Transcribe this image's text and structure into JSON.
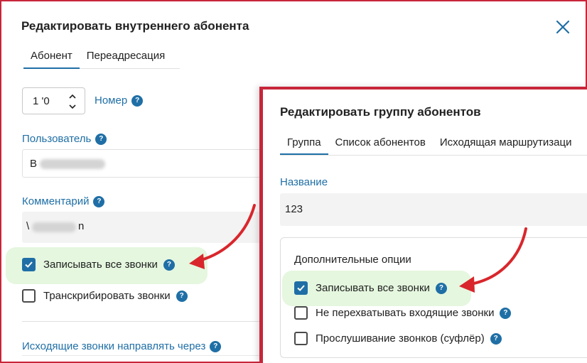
{
  "dialog_user": {
    "title": "Редактировать внутреннего абонента",
    "tabs": [
      {
        "label": "Абонент",
        "active": true
      },
      {
        "label": "Переадресация",
        "active": false
      }
    ],
    "number_value": "1 '0",
    "number_label": "Номер",
    "user_label": "Пользователь",
    "user_value": "В",
    "comment_label": "Комментарий",
    "comment_value_start": "\\",
    "comment_value_end": "n",
    "checkboxes": [
      {
        "label": "Записывать все звонки",
        "checked": true
      },
      {
        "label": "Транскрибировать звонки",
        "checked": false
      }
    ],
    "outgoing_label": "Исходящие звонки направлять через"
  },
  "dialog_group": {
    "title": "Редактировать группу абонентов",
    "tabs": [
      {
        "label": "Группа",
        "active": true
      },
      {
        "label": "Список абонентов",
        "active": false
      },
      {
        "label": "Исходящая маршрутизаци",
        "active": false
      }
    ],
    "name_label": "Название",
    "name_value": "123",
    "options_title": "Дополнительные опции",
    "checkboxes": [
      {
        "label": "Записывать все звонки",
        "checked": true
      },
      {
        "label": "Не перехватывать входящие звонки",
        "checked": false
      },
      {
        "label": "Прослушивание звонков (суфлёр)",
        "checked": false
      }
    ]
  },
  "help_icon_glyph": "?",
  "colors": {
    "accent": "#1f6fa6",
    "annotation_red": "#d9262c",
    "frame_red": "#c8263a",
    "highlight_green": "#e5f7df"
  }
}
